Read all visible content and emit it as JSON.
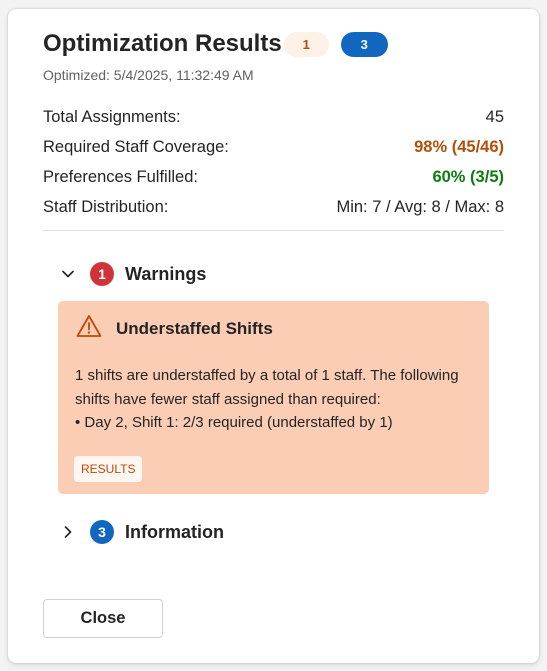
{
  "header": {
    "title": "Optimization Results",
    "warning_count": "1",
    "info_count": "3",
    "timestamp": "Optimized: 5/4/2025, 11:32:49 AM"
  },
  "stats": [
    {
      "label": "Total Assignments:",
      "value": "45",
      "status": "neutral"
    },
    {
      "label": "Required Staff Coverage:",
      "value": "98% (45/46)",
      "status": "warning"
    },
    {
      "label": "Preferences Fulfilled:",
      "value": "60% (3/5)",
      "status": "success"
    },
    {
      "label": "Staff Distribution:",
      "value": "Min: 7 / Avg: 8 / Max: 8",
      "status": "neutral"
    }
  ],
  "warnings": {
    "count": "1",
    "label": "Warnings",
    "expanded": true,
    "items": [
      {
        "title": "Understaffed Shifts",
        "message": "1 shifts are understaffed by a total of 1 staff. The following shifts have fewer staff assigned than required:",
        "detail": "• Day 2, Shift 1: 2/3 required (understaffed by 1)",
        "tag": "RESULTS"
      }
    ]
  },
  "information": {
    "count": "3",
    "label": "Information",
    "expanded": false
  },
  "footer": {
    "close_label": "Close"
  },
  "colors": {
    "warning_accent": "#bc4b09",
    "warning_card_bg": "#fbcdb4",
    "success_text": "#107c10",
    "error_badge": "#d13438",
    "info_badge": "#1167c0"
  },
  "icons": {
    "warnings_chevron": "chevron-down-icon",
    "information_chevron": "chevron-right-icon",
    "warning_item": "warning-triangle-icon"
  }
}
